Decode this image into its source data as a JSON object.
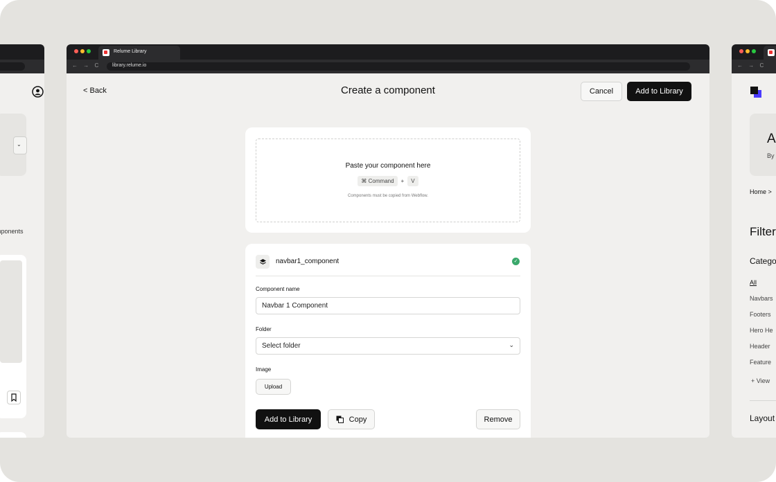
{
  "browser": {
    "tab_title": "Relume Library",
    "url": "library.relume.io",
    "nav_controls": "← → C",
    "traffic_colors": [
      "#ff5f57",
      "#febc2e",
      "#28c840"
    ]
  },
  "header": {
    "back_label": "< Back",
    "title": "Create a component",
    "cancel_label": "Cancel",
    "add_label": "Add to Library"
  },
  "paste": {
    "title": "Paste your component here",
    "key_command": "⌘ Command",
    "plus": "+",
    "key_v": "V",
    "note": "Components must be copied from Webflow."
  },
  "form": {
    "component_id": "navbar1_component",
    "name_label": "Component name",
    "name_value": "Navbar 1 Component",
    "folder_label": "Folder",
    "folder_value": "Select folder",
    "image_label": "Image",
    "upload_label": "Upload",
    "add_label": "Add to Library",
    "copy_label": "Copy",
    "remove_label": "Remove"
  },
  "left_window": {
    "snippet": "mponents"
  },
  "right_window": {
    "hero_letter": "A",
    "hero_sub": "By",
    "breadcrumb": "Home >",
    "filter_heading": "Filter",
    "category_heading": "Catego",
    "categories": [
      "All",
      "Navbars",
      "Footers",
      "Hero He",
      "Header",
      "Feature"
    ],
    "view_more": "+ View",
    "layout_heading": "Layout"
  },
  "colors": {
    "accent_dark": "#111111",
    "success": "#3aa86b",
    "page_bg": "#f1f0ee"
  }
}
